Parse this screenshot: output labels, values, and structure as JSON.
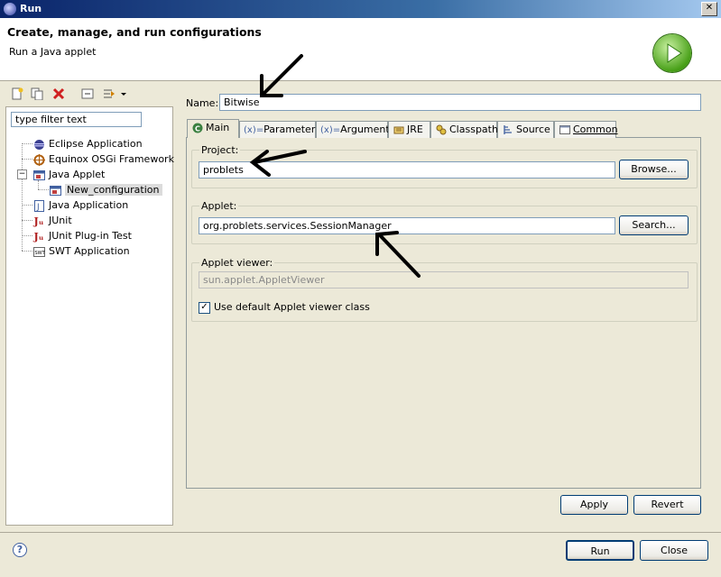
{
  "window": {
    "title": "Run"
  },
  "banner": {
    "heading": "Create, manage, and run configurations",
    "subtitle": "Run a Java applet"
  },
  "filter": {
    "placeholder": "type filter text"
  },
  "tree": [
    {
      "label": "Eclipse Application",
      "icon": "eclipse-icon"
    },
    {
      "label": "Equinox OSGi Framework",
      "icon": "osgi-icon"
    },
    {
      "label": "Java Applet",
      "icon": "applet-icon"
    },
    {
      "label": "New_configuration",
      "icon": "applet-icon"
    },
    {
      "label": "Java Application",
      "icon": "java-app-icon"
    },
    {
      "label": "JUnit",
      "icon": "junit-icon"
    },
    {
      "label": "JUnit Plug-in Test",
      "icon": "junit-plugin-icon"
    },
    {
      "label": "SWT Application",
      "icon": "swt-icon"
    }
  ],
  "name": {
    "label": "Name:",
    "value": "Bitwise"
  },
  "tabs": [
    {
      "label": "Main"
    },
    {
      "label": "Parameters"
    },
    {
      "label": "Arguments"
    },
    {
      "label": "JRE"
    },
    {
      "label": "Classpath"
    },
    {
      "label": "Source"
    },
    {
      "label": "Common"
    }
  ],
  "tab_prefixes": {
    "parameters": "(x)=",
    "arguments": "(x)="
  },
  "project": {
    "label": "Project:",
    "value": "problets",
    "button": "Browse..."
  },
  "applet": {
    "label": "Applet:",
    "value": "org.problets.services.SessionManager",
    "button": "Search..."
  },
  "viewer": {
    "label": "Applet viewer:",
    "value": "sun.applet.AppletViewer",
    "checkbox_label": "Use default Applet viewer class",
    "checked": true
  },
  "buttons": {
    "apply": "Apply",
    "revert": "Revert",
    "run": "Run",
    "close": "Close"
  },
  "help": {
    "symbol": "?"
  },
  "colors": {
    "title_bar": "#0a246a",
    "run_green": "#48a018",
    "dialog_bg": "#ece9d8"
  }
}
